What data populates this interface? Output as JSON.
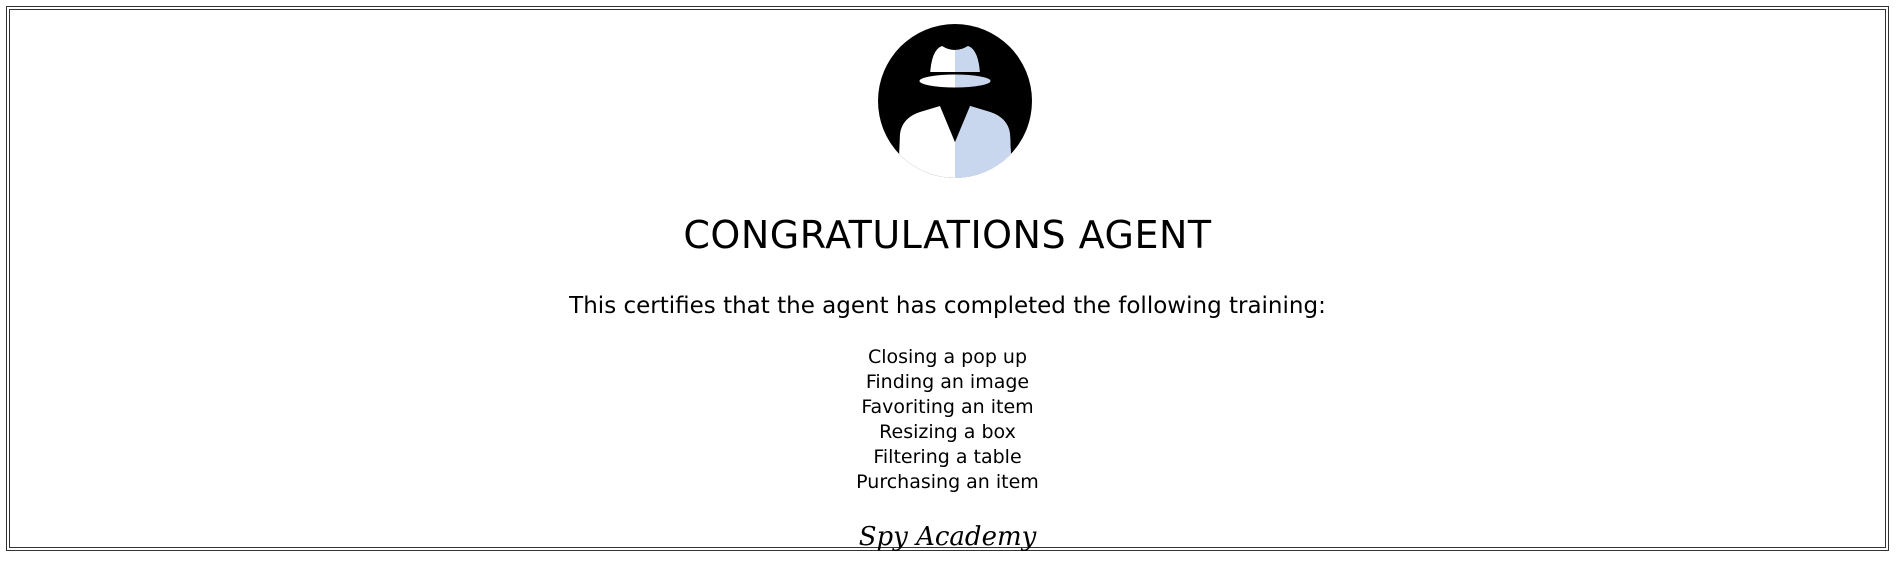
{
  "certificate": {
    "title": "CONGRATULATIONS AGENT",
    "subtitle": "This certifies that the agent has completed the following training:",
    "training_items": [
      "Closing a pop up",
      "Finding an image",
      "Favoriting an item",
      "Resizing a box",
      "Filtering a table",
      "Purchasing an item"
    ],
    "signature": "Spy Academy",
    "avatar_icon": "spy-agent-icon"
  },
  "colors": {
    "avatar_background": "#000000",
    "avatar_accent": "#c9d7ee",
    "border": "#333333"
  }
}
